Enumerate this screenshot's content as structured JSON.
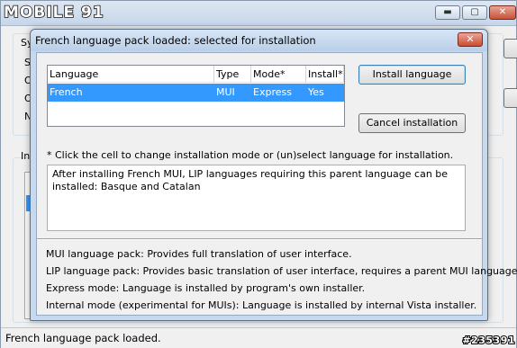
{
  "parent_window": {
    "logo_text": "MOBILE 91",
    "buttons": {
      "minimize_icon": "minimize-icon",
      "maximize_icon": "maximize-icon",
      "close_icon": "close-icon",
      "minimize_glyph": "▬",
      "maximize_glyph": "▢",
      "close_glyph": "✕"
    },
    "fragments": {
      "sy": "Sy",
      "s": "S",
      "o1": "O",
      "o2": "O",
      "n": "N",
      "in": "In"
    },
    "status_text": "French language pack loaded.",
    "watermark": "#235391"
  },
  "dialog": {
    "title": "French language pack loaded: selected for installation",
    "close_glyph": "✕",
    "table": {
      "headers": [
        "Language",
        "Type",
        "Mode*",
        "Install*"
      ],
      "rows": [
        [
          "French",
          "MUI",
          "Express",
          "Yes"
        ]
      ]
    },
    "install_button": "Install language",
    "cancel_button": "Cancel installation",
    "hint": "* Click the cell to change installation mode or (un)select language for installation.",
    "info_text": "After installing French MUI, LIP languages requiring this parent language can be installed: Basque and Catalan",
    "legend": [
      "MUI language pack: Provides full translation of user interface.",
      "LIP language pack: Provides basic translation of user interface, requires a parent MUI language.",
      "Express mode: Language is installed by program's own installer.",
      "Internal mode (experimental for MUIs): Language is installed by internal Vista installer."
    ]
  }
}
